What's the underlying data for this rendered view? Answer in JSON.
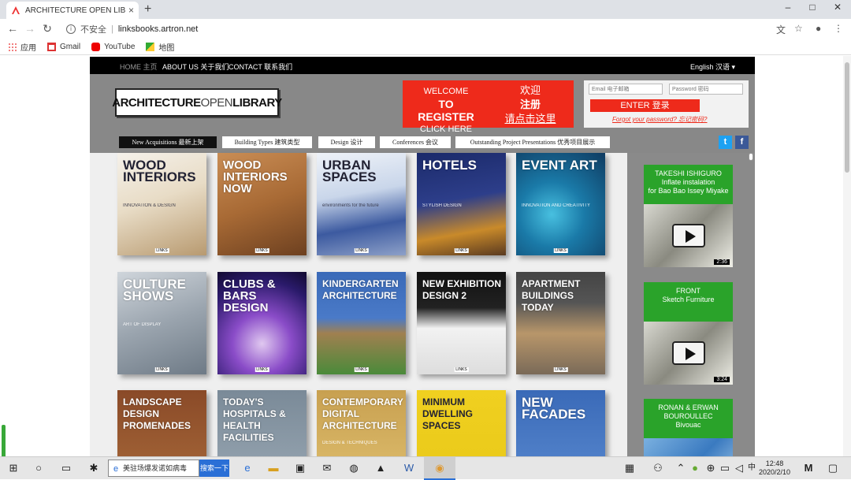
{
  "browser": {
    "tab_title": "ARCHITECTURE OPEN LIBRARY",
    "tab_close": "×",
    "new_tab": "+",
    "insecure_label": "不安全",
    "url": "linksbooks.artron.net",
    "window": {
      "minimize": "–",
      "maximize": "□",
      "close": "✕"
    },
    "bookmarks": [
      {
        "label": "应用",
        "icon": "apps-grid-icon"
      },
      {
        "label": "Gmail",
        "icon": "gmail-icon"
      },
      {
        "label": "YouTube",
        "icon": "youtube-icon"
      },
      {
        "label": "地图",
        "icon": "maps-icon"
      }
    ]
  },
  "site": {
    "topnav": {
      "home": "HOME 主页",
      "about": "ABOUT US 关于我们",
      "contact": "CONTACT 联系我们",
      "language": "English 汉语 ▾"
    },
    "logo": {
      "main": "ARCHITECTURE",
      "open": "OPEN",
      "library": "LIBRARY"
    },
    "welcome": {
      "en_line1": "WELCOME",
      "en_line2": "TO REGISTER",
      "en_line3": "CLICK HERE",
      "zh_line1": "欢迎",
      "zh_line2": "注册",
      "zh_line3": "请点击这里"
    },
    "login": {
      "email_placeholder": "Email 电子邮箱",
      "password_placeholder": "Password 密码",
      "enter_label": "ENTER 登录",
      "forgot": "Forgot your password? 忘记密码?"
    },
    "categories": [
      "New Acquisitions 最新上架",
      "Building Types 建筑类型",
      "Design 设计",
      "Conferences 会议",
      "Outstanding Project Presentations 优秀项目展示"
    ],
    "books": [
      {
        "title": "WOOD INTERIORS",
        "subtitle": "INNOVATION & DESIGN",
        "publisher": "LINKS",
        "bg": "linear-gradient(160deg,#f5f1ea 0%,#e8dcc6 45%,#b89a70 100%)",
        "dark": true
      },
      {
        "title": "WOOD INTERIORS NOW",
        "subtitle": "",
        "publisher": "LINKS",
        "bg": "linear-gradient(160deg,#c98d55 0%,#a86a35 50%,#6d4020 100%)",
        "dark": false
      },
      {
        "title": "URBAN SPACES",
        "subtitle": "environments for the future",
        "publisher": "LINKS",
        "bg": "linear-gradient(170deg,#eef2f8 0%,#c9d6ea 40%,#3c5aa0 70%,#8da0c8 100%)",
        "dark": true
      },
      {
        "title": "HOTELS",
        "subtitle": "STYLISH DESIGN",
        "publisher": "LINKS",
        "bg": "linear-gradient(170deg,#1b2a6a 0%,#2d3e8a 45%,#c98a2a 75%,#5a3a20 100%)",
        "dark": false
      },
      {
        "title": "EVENT ART",
        "subtitle": "INNOVATION AND CREATIVITY",
        "publisher": "LINKS",
        "bg": "radial-gradient(circle at 40% 60%,#48c0e0 0%,#1a7aa8 40%,#0f3a60 100%)",
        "dark": false
      },
      {
        "title": "CULTURE SHOWS",
        "subtitle": "ART OF DISPLAY",
        "publisher": "LINKS",
        "bg": "linear-gradient(160deg,#cfd5db 0%,#9aa4ae 50%,#6e7a86 100%)",
        "dark": false
      },
      {
        "title": "CLUBS & BARS DESIGN",
        "subtitle": "",
        "publisher": "LINKS",
        "bg": "radial-gradient(circle at 50% 70%,#e0c8f0 0%,#8a4cc8 35%,#2a1a6a 75%,#120a30 100%)",
        "dark": false
      },
      {
        "title": "KINDERGARTEN ARCHITECTURE",
        "subtitle": "",
        "publisher": "LINKS",
        "bg": "linear-gradient(180deg,#3a6ab8 0%,#4a7ac8 45%,#a08050 60%,#4a8a3a 100%)",
        "dark": false
      },
      {
        "title": "NEW EXHIBITION DESIGN 2",
        "subtitle": "",
        "publisher": "LINKS",
        "bg": "linear-gradient(180deg,#111 0%,#222 35%,#f2f2f2 55%,#ddd 100%)",
        "dark": false
      },
      {
        "title": "APARTMENT BUILDINGS TODAY",
        "subtitle": "",
        "publisher": "LINKS",
        "bg": "linear-gradient(180deg,#444 0%,#555 30%,#b8966a 60%,#7a6a58 100%)",
        "dark": false
      },
      {
        "title": "LANDSCAPE DESIGN PROMENADES",
        "subtitle": "",
        "publisher": "",
        "bg": "linear-gradient(180deg,#8a4a28 0%,#a86a3a 100%)",
        "dark": false
      },
      {
        "title": "TODAY'S HOSPITALS & HEALTH FACILITIES",
        "subtitle": "",
        "publisher": "",
        "bg": "linear-gradient(180deg,#7a8a98 0%,#9aa8b4 100%)",
        "dark": false
      },
      {
        "title": "CONTEMPORARY DIGITAL ARCHITECTURE",
        "subtitle": "DESIGN & TECHNIQUES",
        "publisher": "",
        "bg": "linear-gradient(180deg,#c8a050 0%,#e0c070 100%)",
        "dark": false
      },
      {
        "title": "MINIMUM DWELLING SPACES",
        "subtitle": "",
        "publisher": "",
        "bg": "linear-gradient(180deg,#f0d020 0%,#e8c818 100%)",
        "dark": true
      },
      {
        "title": "NEW FACADES",
        "subtitle": "",
        "publisher": "",
        "bg": "linear-gradient(180deg,#3a6ab8 0%,#5a8ad0 100%)",
        "dark": false
      }
    ],
    "videos": [
      {
        "line1": "TAKESHI ISHIGURO",
        "line2": "Inflate instalation",
        "line3": "for Bao Bao Issey Miyake",
        "duration": "2:36"
      },
      {
        "line1": "FRONT",
        "line2": "Sketch Furniture",
        "line3": "",
        "duration": "3:24"
      },
      {
        "line1": "RONAN & ERWAN",
        "line2": "BOUROULLEC",
        "line3": "Bivouac",
        "duration": ""
      }
    ]
  },
  "taskbar": {
    "search_text": "美驻场爆发诺如病毒",
    "search_button": "搜索一下",
    "time": "12:48",
    "date": "2020/2/10",
    "ime": "中"
  },
  "colors": {
    "accent_red": "#ee2a1b",
    "video_green": "#2aa32a",
    "twitter": "#1da1f2",
    "facebook": "#3b5998"
  }
}
